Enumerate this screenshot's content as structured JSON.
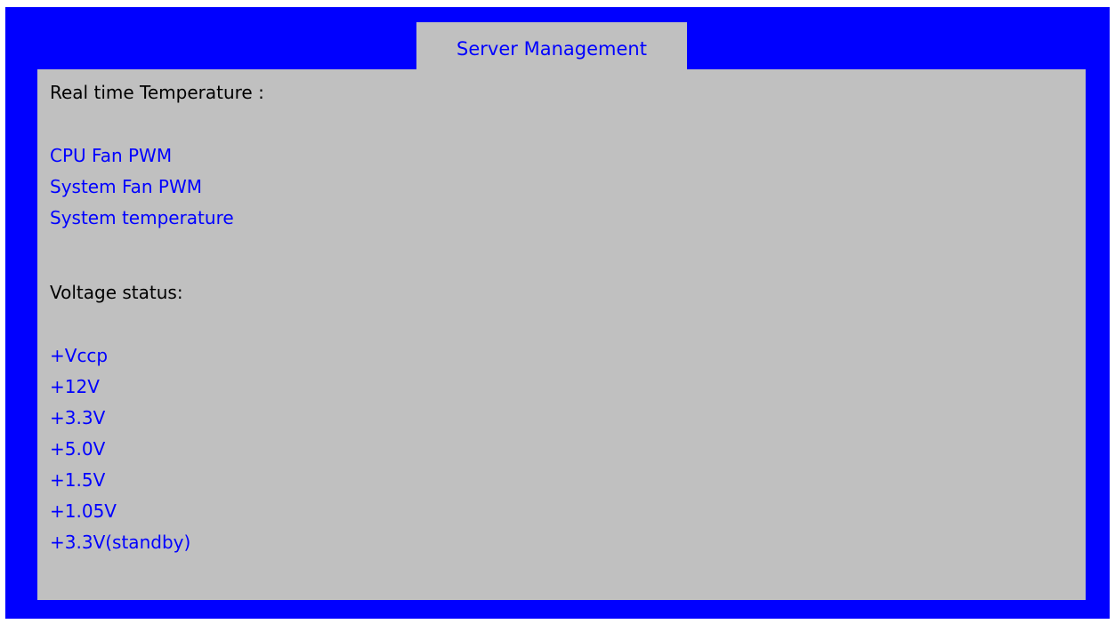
{
  "colors": {
    "frame": "#0000ff",
    "panel": "#c0c0c0",
    "item_text": "#0000ff",
    "header_text": "#000000"
  },
  "tabs": [
    {
      "label": "Server Management",
      "active": true
    }
  ],
  "main": {
    "temperature_section": {
      "header": "Real time Temperature :",
      "items": [
        {
          "label": "CPU Fan PWM"
        },
        {
          "label": "System Fan PWM"
        },
        {
          "label": "System temperature"
        }
      ]
    },
    "voltage_section": {
      "header": "Voltage status:",
      "items": [
        {
          "label": "+Vccp"
        },
        {
          "label": "+12V"
        },
        {
          "label": "+3.3V"
        },
        {
          "label": "+5.0V"
        },
        {
          "label": "+1.5V"
        },
        {
          "label": "+1.05V"
        },
        {
          "label": "+3.3V(standby)"
        }
      ]
    }
  }
}
